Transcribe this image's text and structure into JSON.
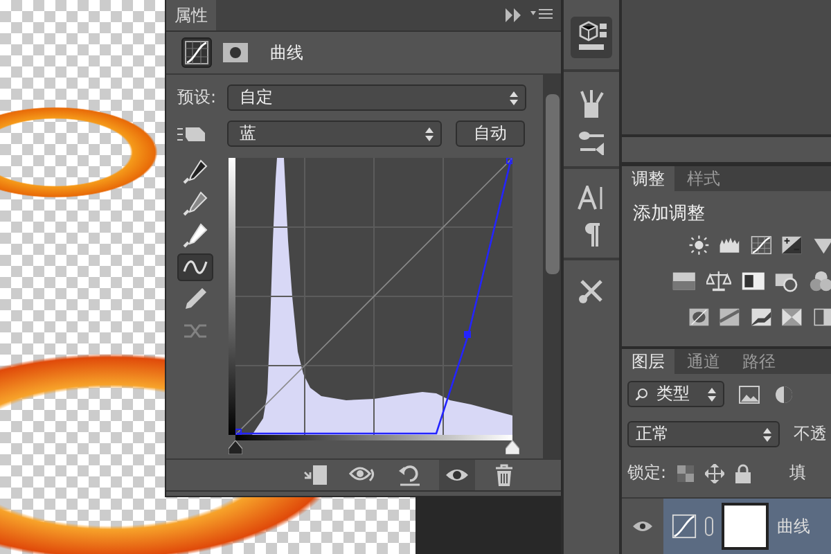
{
  "properties": {
    "tab": "属性",
    "modes": [
      {
        "kind": "curves",
        "selected": true
      },
      {
        "kind": "mask",
        "selected": false
      }
    ],
    "title": "曲线",
    "input_sliders": [
      {
        "level": 0
      },
      {
        "level": 1
      }
    ],
    "preset_label": "预设:",
    "preset": "自定",
    "channel": "蓝",
    "auto_button": "自动",
    "tools": [
      {
        "kind": "black-eyedropper",
        "selected": false,
        "disabled": false
      },
      {
        "kind": "gray-eyedropper",
        "selected": false,
        "disabled": false
      },
      {
        "kind": "white-eyedropper",
        "selected": false,
        "disabled": false
      },
      {
        "kind": "curve-point",
        "selected": true,
        "disabled": false
      },
      {
        "kind": "pencil",
        "selected": false,
        "disabled": false
      },
      {
        "kind": "smooth",
        "selected": false,
        "disabled": true
      }
    ],
    "footer": [
      {
        "kind": "clip",
        "selected": false
      },
      {
        "kind": "view-previous",
        "selected": false
      },
      {
        "kind": "reset",
        "selected": false
      },
      {
        "kind": "visibility",
        "selected": true
      },
      {
        "kind": "delete",
        "selected": false
      }
    ]
  },
  "adjustments": {
    "tabs": [
      {
        "label": "调整",
        "selected": true
      },
      {
        "label": "样式",
        "selected": false
      }
    ],
    "heading": "添加调整"
  },
  "layers": {
    "tabs": [
      {
        "label": "图层",
        "selected": true
      },
      {
        "label": "通道",
        "selected": false
      },
      {
        "label": "路径",
        "selected": false
      }
    ],
    "filter": "类型",
    "blend_mode": "正常",
    "opacity_label": "不透",
    "lock_label": "锁定:",
    "fill_label": "填",
    "layer": {
      "name": "曲线",
      "selected": true,
      "visible": true
    }
  }
}
